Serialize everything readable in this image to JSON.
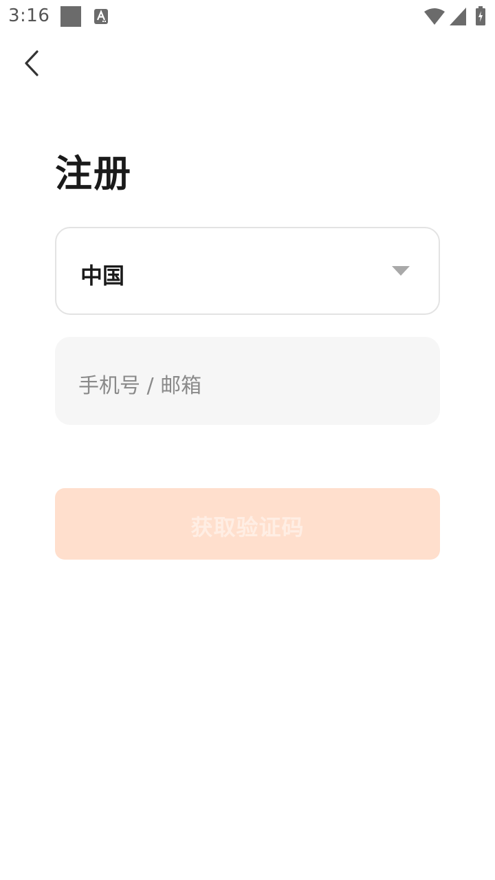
{
  "status_bar": {
    "time": "3:16",
    "notification_icons": [
      "square-notification-icon",
      "a-notification-icon"
    ],
    "system_icons": [
      "wifi-icon",
      "signal-icon",
      "battery-icon"
    ]
  },
  "header": {
    "back_icon": "chevron-left-icon"
  },
  "page": {
    "title": "注册"
  },
  "form": {
    "country": {
      "selected": "中国",
      "icon": "chevron-down-icon"
    },
    "account": {
      "placeholder": "手机号 / 邮箱",
      "value": ""
    },
    "submit_label": "获取验证码"
  },
  "colors": {
    "accent_disabled": "#ffdfcd",
    "input_background": "#f6f6f6",
    "title": "#1a1a1a"
  }
}
